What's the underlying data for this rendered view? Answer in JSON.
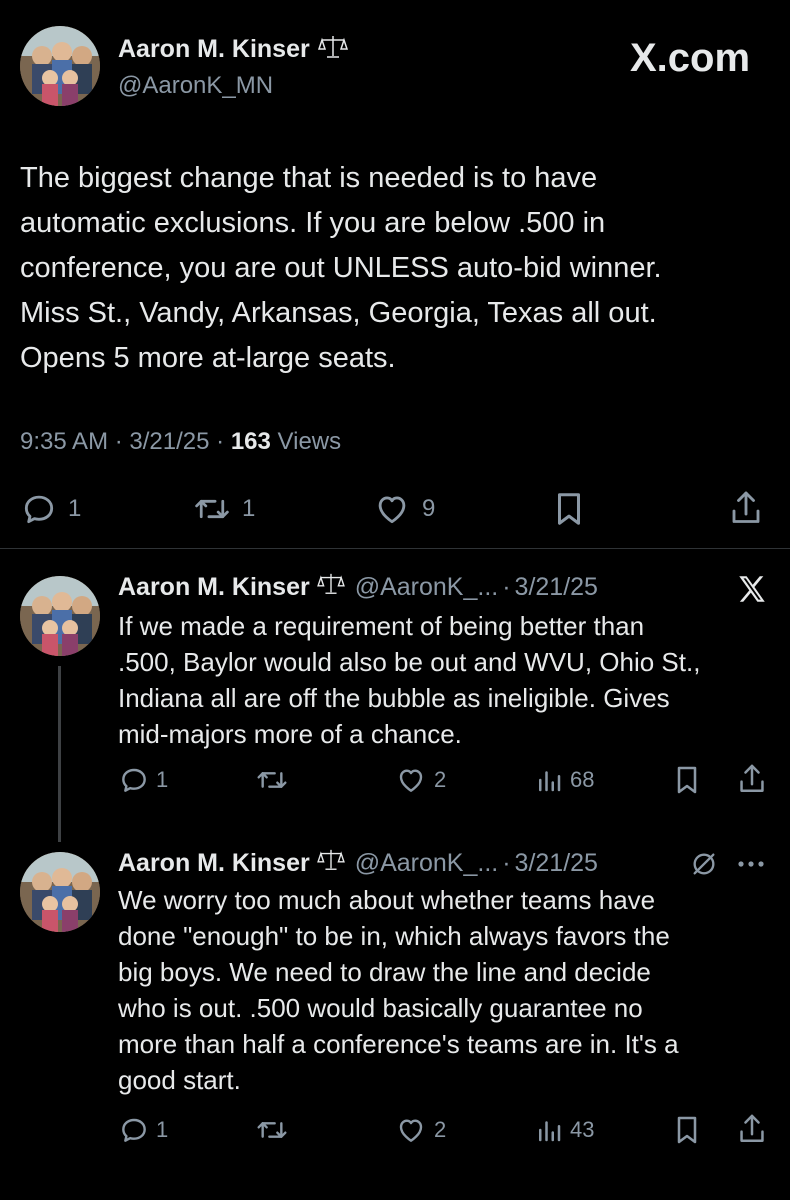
{
  "watermark": "X.com",
  "main_tweet": {
    "name": "Aaron M. Kinser",
    "handle": "@AaronK_MN",
    "text_lines": [
      "The biggest change that is needed is to have",
      "automatic exclusions. If you are below .500 in",
      "conference, you are out UNLESS auto-bid winner.",
      "Miss St., Vandy, Arkansas, Georgia, Texas all out.",
      "Opens 5 more at-large seats."
    ],
    "time": "9:35 AM",
    "date": "3/21/25",
    "views_count": "163",
    "views_label": "Views",
    "replies": "1",
    "retweets": "1",
    "likes": "9"
  },
  "replies": [
    {
      "name": "Aaron M. Kinser",
      "handle": "@AaronK_...",
      "date": "3/21/25",
      "corner_icon": "x-logo-icon",
      "text_lines": [
        "If we made a requirement of being better than",
        ".500, Baylor would also be out and WVU, Ohio St.,",
        "Indiana all are off the bubble as ineligible. Gives",
        "mid-majors more of a chance."
      ],
      "replies": "1",
      "retweets": "",
      "likes": "2",
      "views": "68"
    },
    {
      "name": "Aaron M. Kinser",
      "handle": "@AaronK_...",
      "date": "3/21/25",
      "corner_icon": "grok-icon",
      "text_lines": [
        "We worry too much about whether teams have",
        "done \"enough\" to be in, which always favors the",
        "big boys. We need to draw the line and decide",
        "who is out. .500 would basically guarantee no",
        "more than half a conference's teams are in. It's a",
        "good start."
      ],
      "replies": "1",
      "retweets": "",
      "likes": "2",
      "views": "43"
    }
  ],
  "colors": {
    "background": "#000000",
    "text": "#e7e9ea",
    "secondary": "#8b98a5",
    "divider": "#2f3336"
  }
}
